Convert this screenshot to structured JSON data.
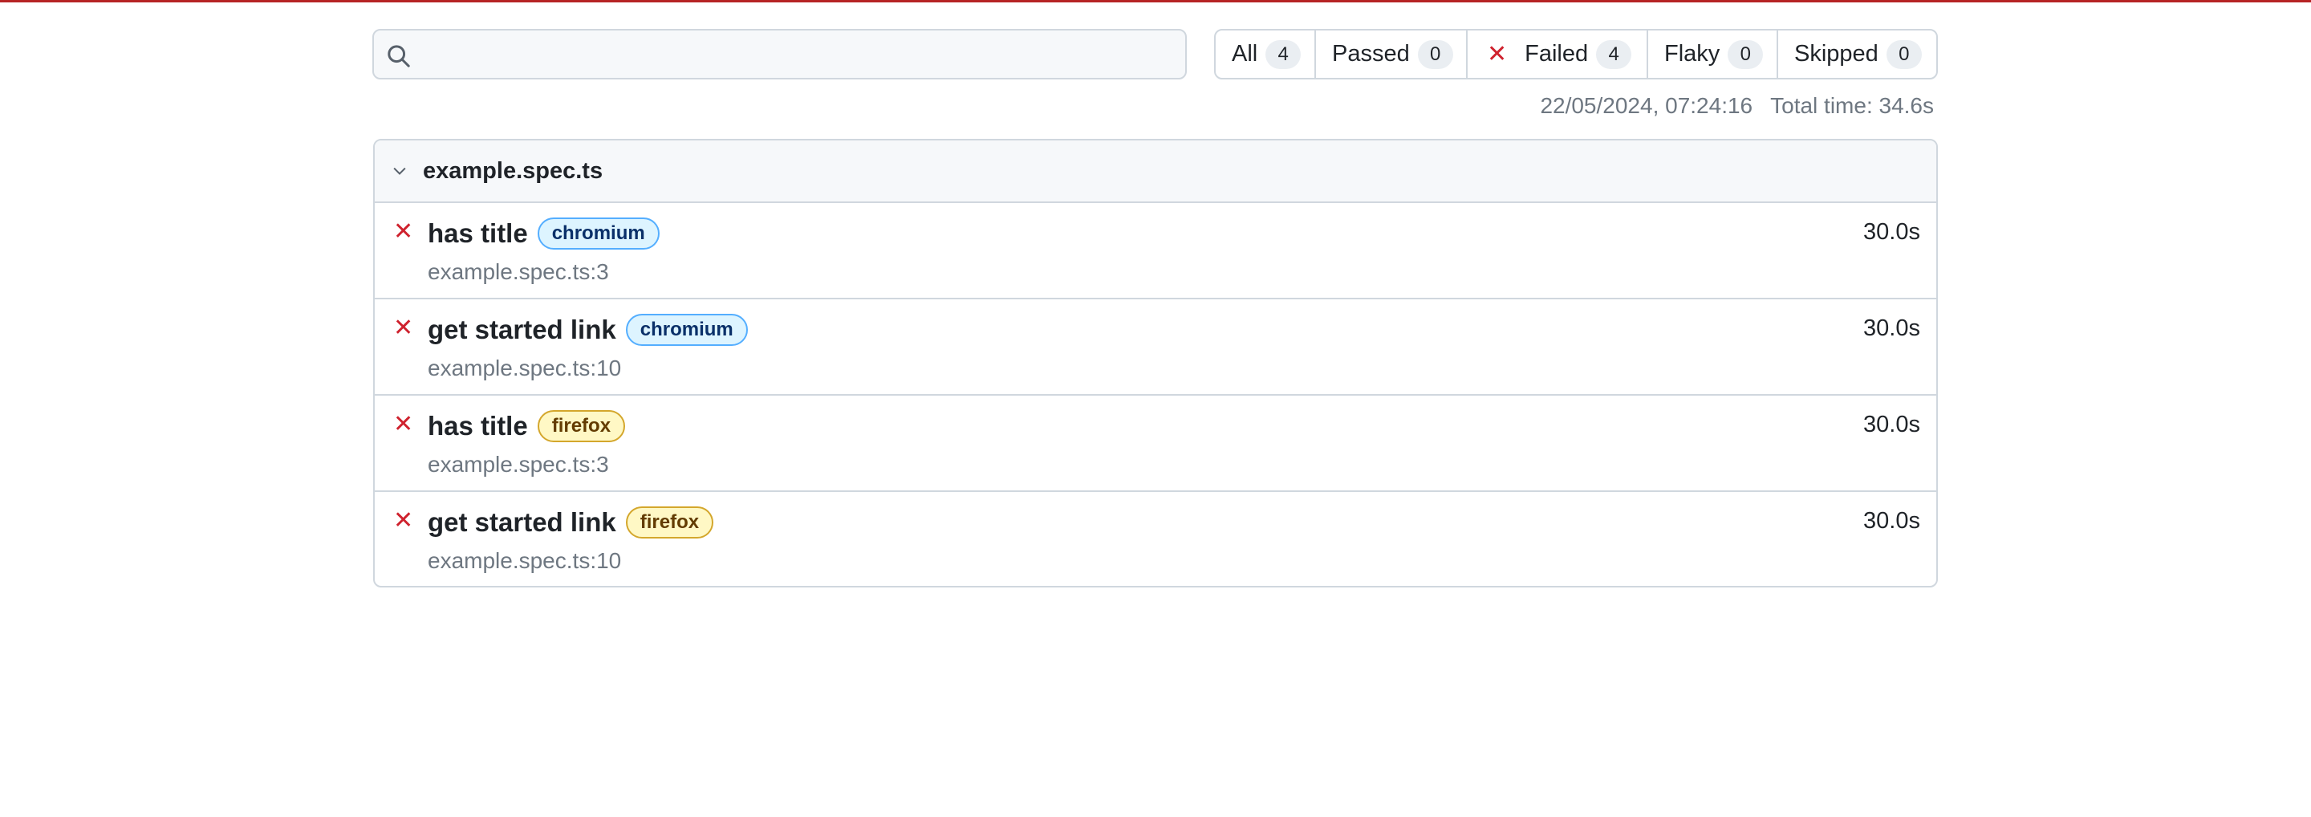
{
  "search": {
    "value": "",
    "placeholder": ""
  },
  "filters": [
    {
      "label": "All",
      "count": "4"
    },
    {
      "label": "Passed",
      "count": "0"
    },
    {
      "label": "Failed",
      "count": "4",
      "icon": "x-icon"
    },
    {
      "label": "Flaky",
      "count": "0"
    },
    {
      "label": "Skipped",
      "count": "0"
    }
  ],
  "meta": {
    "timestamp": "22/05/2024, 07:24:16",
    "total_time": "Total time: 34.6s"
  },
  "file": {
    "name": "example.spec.ts",
    "expanded": true,
    "tests": [
      {
        "status": "failed",
        "title": "has title",
        "project": "chromium",
        "location": "example.spec.ts:3",
        "duration": "30.0s"
      },
      {
        "status": "failed",
        "title": "get started link",
        "project": "chromium",
        "location": "example.spec.ts:10",
        "duration": "30.0s"
      },
      {
        "status": "failed",
        "title": "has title",
        "project": "firefox",
        "location": "example.spec.ts:3",
        "duration": "30.0s"
      },
      {
        "status": "failed",
        "title": "get started link",
        "project": "firefox",
        "location": "example.spec.ts:10",
        "duration": "30.0s"
      }
    ]
  },
  "colors": {
    "top_bar": "#b62324",
    "failed": "#cf222e",
    "chromium_badge": "#ddf4ff",
    "firefox_badge": "#fff8c5"
  },
  "icons": {
    "fail": "✕"
  }
}
